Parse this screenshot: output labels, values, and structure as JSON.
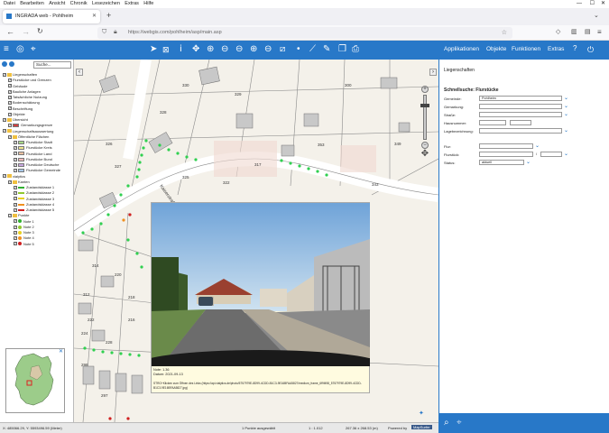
{
  "menubar": [
    "Datei",
    "Bearbeiten",
    "Ansicht",
    "Chronik",
    "Lesezeichen",
    "Extras",
    "Hilfe"
  ],
  "tab": {
    "title": "INGRADA web - Pohlheim",
    "new_tab": "+"
  },
  "url": "https://webgis.com/pohlheim/asp/main.asp",
  "appmenu": {
    "applikationen": "Applikationen",
    "objekte": "Objekte",
    "funktionen": "Funktionen",
    "extras": "Extras",
    "help": "?"
  },
  "search": {
    "placeholder": "Suche..."
  },
  "tree": [
    {
      "label": "Liegenschaften",
      "x": 6,
      "indent": 0,
      "kind": "folder"
    },
    {
      "label": "Flurstücke und Grenzen",
      "indent": 1,
      "kind": "cb"
    },
    {
      "label": "Gebäude",
      "indent": 1,
      "kind": "cb"
    },
    {
      "label": "Bauliche Anlagen",
      "indent": 1,
      "kind": "cb"
    },
    {
      "label": "Tatsächliche Nutzung",
      "indent": 1,
      "kind": "cb"
    },
    {
      "label": "Bodenschätzung",
      "indent": 1,
      "kind": "cb"
    },
    {
      "label": "Beschriftung",
      "indent": 1,
      "kind": "cb"
    },
    {
      "label": "Objekte",
      "indent": 1,
      "kind": "cb"
    },
    {
      "label": "Übersicht",
      "indent": 0,
      "kind": "folder"
    },
    {
      "label": "Gemarkungsgrenze",
      "indent": 1,
      "kind": "swatch",
      "color": "#d04040"
    },
    {
      "label": "Liegenschaftsauswertung",
      "indent": 0,
      "kind": "folder"
    },
    {
      "label": "Öffentliche Flächen",
      "indent": 1,
      "kind": "folder"
    },
    {
      "label": "Flurstücke Stadt",
      "indent": 2,
      "kind": "swatch",
      "color": "#a8d888"
    },
    {
      "label": "Flurstücke Kreis",
      "indent": 2,
      "kind": "swatch",
      "color": "#f0e890"
    },
    {
      "label": "Flurstücke Land",
      "indent": 2,
      "kind": "swatch",
      "color": "#e8c0a0"
    },
    {
      "label": "Flurstücke Bund",
      "indent": 2,
      "kind": "swatch",
      "color": "#f0b8b8"
    },
    {
      "label": "Flurstücke Deutsche",
      "indent": 2,
      "kind": "swatch",
      "color": "#c8a8e0"
    },
    {
      "label": "Flurstücke Gemeinde",
      "indent": 2,
      "kind": "swatch",
      "color": "#a8c8e8"
    },
    {
      "label": "vialytics",
      "indent": 0,
      "kind": "folder"
    },
    {
      "label": "Kanten",
      "indent": 1,
      "kind": "folder"
    },
    {
      "label": "Zustandsklasse 1",
      "indent": 2,
      "kind": "line",
      "color": "#30b030"
    },
    {
      "label": "Zustandsklasse 2",
      "indent": 2,
      "kind": "line",
      "color": "#90c830"
    },
    {
      "label": "Zustandsklasse 3",
      "indent": 2,
      "kind": "line",
      "color": "#e8d020"
    },
    {
      "label": "Zustandsklasse 4",
      "indent": 2,
      "kind": "line",
      "color": "#f09020"
    },
    {
      "label": "Zustandsklasse 5",
      "indent": 2,
      "kind": "line",
      "color": "#d02020"
    },
    {
      "label": "Punkte",
      "indent": 1,
      "kind": "folder"
    },
    {
      "label": "Note 1",
      "indent": 2,
      "kind": "dot",
      "color": "#30b030"
    },
    {
      "label": "Note 2",
      "indent": 2,
      "kind": "dot",
      "color": "#90c830"
    },
    {
      "label": "Note 3",
      "indent": 2,
      "kind": "dot",
      "color": "#e8d020"
    },
    {
      "label": "Note 4",
      "indent": 2,
      "kind": "dot",
      "color": "#f09020"
    },
    {
      "label": "Note 5",
      "indent": 2,
      "kind": "dot",
      "color": "#d02020"
    }
  ],
  "map_labels": [
    "330",
    "329",
    "328",
    "326",
    "327",
    "325",
    "322",
    "317",
    "343",
    "353",
    "349",
    "300",
    "216",
    "314",
    "218",
    "312",
    "220",
    "222",
    "224",
    "228",
    "298",
    "297"
  ],
  "street": "Kaiserstraße",
  "popup": {
    "note": "Note: 1.36",
    "datum": "Datum: 2021-09-13",
    "link1": "STRG+Klicken zum Öffnen des Links (https://api.vialytics.de/photo/5757979E-8D99-4CDD-B1C3-9E16BFAA5827/medium_frame_6f9f498_5757979E-8D99-4CDD-",
    "link2": "B1C3-9E16BFAA5827.jpg)"
  },
  "status": {
    "coords": "X: 485066.29, Y: 5593496.59 (Meter)",
    "selected": "1 Punkte ausgewählt",
    "scale": "1 : 1.012",
    "size": "267.36 x 268.53 (m)",
    "powered": "Powered by",
    "brand": "MapSurfer"
  },
  "right": {
    "header": "Liegenschaften",
    "title": "Schnellsuche: Flurstücke",
    "fields": [
      {
        "label": "Gemeinde:",
        "value": "Pohlheim"
      },
      {
        "label": "Gemarkung:",
        "value": ""
      },
      {
        "label": "Straße:",
        "value": ""
      },
      {
        "label": "Hausnummer:",
        "value": ""
      },
      {
        "label": "Lagebezeichnung:",
        "value": ""
      },
      {
        "label": "Flur:",
        "value": ""
      },
      {
        "label": "Flurstück:",
        "value": "/"
      },
      {
        "label": "Status:",
        "value": "aktuell"
      }
    ]
  },
  "colors": {
    "accent": "#2878c8",
    "good": "#30d050"
  }
}
